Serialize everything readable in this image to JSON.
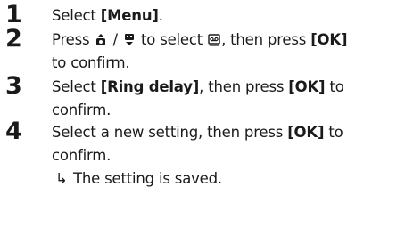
{
  "steps": [
    {
      "number": "1",
      "pre": "Select ",
      "button": "[Menu]",
      "post": "."
    },
    {
      "number": "2",
      "pre": "Press ",
      "sep": " / ",
      "mid": " to select ",
      "mid2": ", then press ",
      "button": "[OK]",
      "line2": "to confirm.",
      "icons": [
        "up-nav-key-icon",
        "down-nav-key-icon",
        "phone-settings-icon"
      ]
    },
    {
      "number": "3",
      "pre": "Select ",
      "button": "[Ring delay]",
      "mid": ", then press ",
      "button2": "[OK]",
      "post": " to",
      "line2": "confirm."
    },
    {
      "number": "4",
      "pre": "Select a new setting, then press ",
      "button": "[OK]",
      "post": " to",
      "line2": "confirm.",
      "result_arrow": "↳",
      "result": "The setting is saved."
    }
  ]
}
